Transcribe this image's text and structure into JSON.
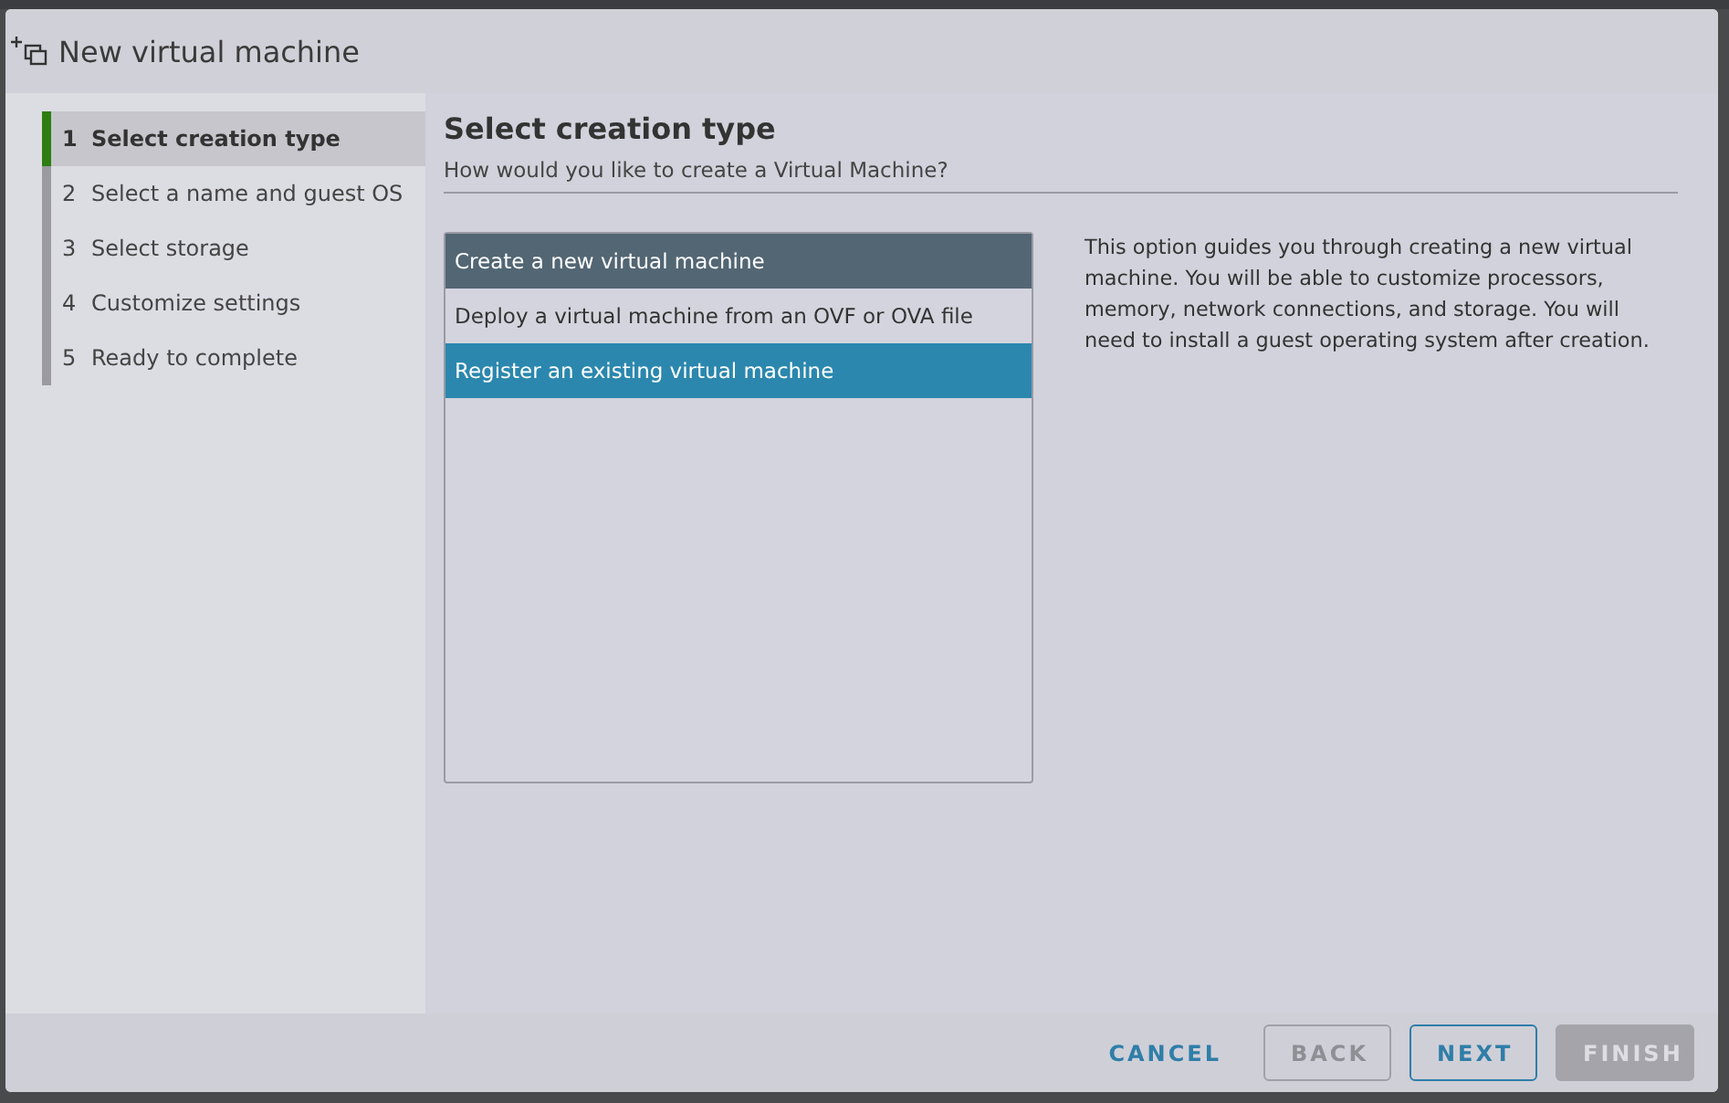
{
  "dialog": {
    "title": "New virtual machine"
  },
  "steps": [
    {
      "number": "1",
      "label": "Select creation type",
      "selected": true
    },
    {
      "number": "2",
      "label": "Select a name and guest OS",
      "selected": false
    },
    {
      "number": "3",
      "label": "Select storage",
      "selected": false
    },
    {
      "number": "4",
      "label": "Customize settings",
      "selected": false
    },
    {
      "number": "5",
      "label": "Ready to complete",
      "selected": false
    }
  ],
  "page": {
    "title": "Select creation type",
    "subtitle": "How would you like to create a Virtual Machine?"
  },
  "options": [
    {
      "label": "Create a new virtual machine",
      "selected": true,
      "hovered": false
    },
    {
      "label": "Deploy a virtual machine from an OVF or OVA file",
      "selected": false,
      "hovered": false
    },
    {
      "label": "Register an existing virtual machine",
      "selected": false,
      "hovered": true
    }
  ],
  "description": "This option guides you through creating a new virtual machine. You will be able to customize processors, memory, network connections, and storage. You will need to install a guest operating system after creation.",
  "buttons": [
    {
      "label": "CANCEL",
      "kind": "link",
      "disabled": false
    },
    {
      "label": "BACK",
      "kind": "outline",
      "disabled": true
    },
    {
      "label": "NEXT",
      "kind": "outline",
      "disabled": false
    },
    {
      "label": "FINISH",
      "kind": "solid",
      "disabled": true
    }
  ]
}
